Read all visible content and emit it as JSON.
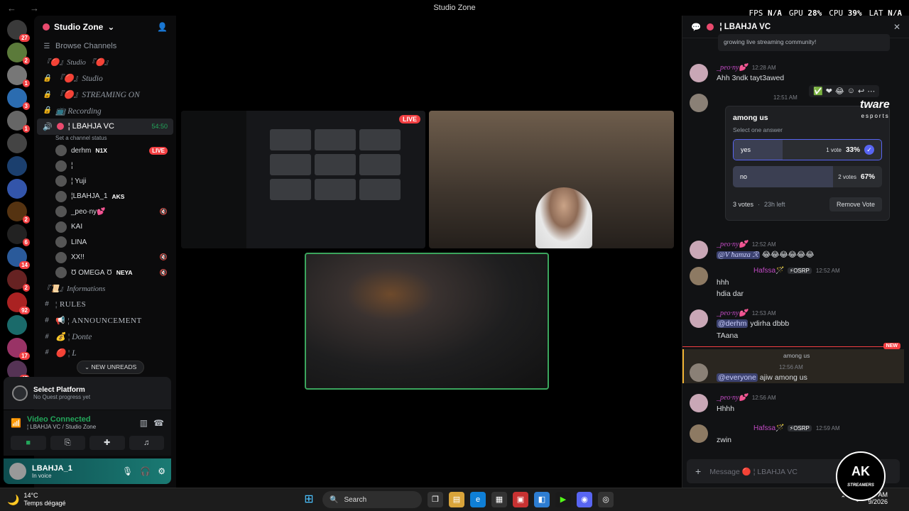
{
  "topbar": {
    "back": "←",
    "forward": "→",
    "title": "Studio Zone"
  },
  "stats": {
    "fps_label": "FPS",
    "fps": "N/A",
    "gpu_label": "GPU",
    "gpu": "28%",
    "cpu_label": "CPU",
    "cpu": "39%",
    "lat_label": "LAT",
    "lat": "N/A"
  },
  "guilds": {
    "badges": [
      "27",
      "2",
      "1",
      "3",
      "1",
      "",
      "",
      "",
      "2",
      "6",
      "14",
      "2",
      "92",
      "",
      "17",
      "47"
    ],
    "new_label": "NEW"
  },
  "server": {
    "name": "Studio Zone",
    "browse": "Browse Channels"
  },
  "channels": [
    {
      "label": "『🔴』Studio 『🔴』",
      "kind": "cat"
    },
    {
      "label": "『🔴』Studio",
      "kind": "it"
    },
    {
      "label": "『🔴』STREAMING ON",
      "kind": "it"
    },
    {
      "label": "📺 Recording",
      "kind": "it"
    }
  ],
  "active_channel": {
    "name": "¦ LBAHJA VC",
    "timer": "54:50",
    "status": "Set a channel status"
  },
  "voice_users": [
    {
      "name": "derhm",
      "tag": "N1X",
      "live": "LIVE"
    },
    {
      "name": "¦",
      "tag": "",
      "live": ""
    },
    {
      "name": "¦ Yuji",
      "tag": "",
      "live": ""
    },
    {
      "name": "¦LBAHJA_1",
      "tag": "AKS",
      "live": ""
    },
    {
      "name": "_peo·ny💕",
      "tag": "",
      "live": ""
    },
    {
      "name": "KAI",
      "tag": "",
      "live": ""
    },
    {
      "name": "LINA",
      "tag": "",
      "live": ""
    },
    {
      "name": "XX!!",
      "tag": "",
      "live": ""
    },
    {
      "name": "Ʊ ОМЕGА Ʊ",
      "tag": "NEYA",
      "live": ""
    }
  ],
  "info_channels": [
    {
      "label": "『📜』Informations",
      "kind": "cat"
    },
    {
      "label": "¦ RULES",
      "kind": "norm"
    },
    {
      "label": "📢 ¦ ANNOUNCEMENT",
      "kind": "norm"
    },
    {
      "label": "💰 ¦ Donte",
      "kind": "it"
    },
    {
      "label": "🔴 ¦ L",
      "kind": "it"
    }
  ],
  "new_unreads": "NEW UNREADS",
  "quest": {
    "title": "Select Platform",
    "subtitle": "No Quest progress yet"
  },
  "voice": {
    "status": "Video Connected",
    "location": "¦ LBAHJA VC / Studio Zone"
  },
  "user": {
    "name": "LBAHJA_1",
    "status": "In voice"
  },
  "stage": {
    "live_label": "LIVE"
  },
  "thread": {
    "title": "¦ LBAHJA VC",
    "intro": "growing live streaming community!",
    "messages": [
      {
        "name": "_peo·ny💕",
        "time": "12:28 AM",
        "text": "Ahh 3ndk tayt3awed"
      },
      {
        "name": "",
        "time": "12:51 AM",
        "text": ""
      },
      {
        "name": "_peo·ny💕",
        "time": "12:52 AM",
        "mention": "@V ħamza ℛ",
        "text": "😂😂😂😂😂😂"
      },
      {
        "name": "Hafssa🪄",
        "badge": "⚡OSRP",
        "time": "12:52 AM",
        "text": "hhh",
        "text2": "hdia dar"
      },
      {
        "name": "_peo·ny💕",
        "time": "12:53 AM",
        "mention": "@derhm",
        "text": "ydirha dbbb",
        "text2": "TAana"
      },
      {
        "name": "",
        "time": "12:56 AM",
        "reply": "among us",
        "mention": "@everyone",
        "text": "ajiw among us"
      },
      {
        "name": "_peo·ny💕",
        "time": "12:56 AM",
        "text": "Hhhh"
      },
      {
        "name": "Hafssa🪄",
        "badge": "⚡OSRP",
        "time": "12:59 AM",
        "text": "zwin"
      }
    ],
    "new_tag": "NEW",
    "input_placeholder": "Message 🔴 ¦ LBAHJA VC"
  },
  "poll": {
    "question": "among us",
    "subtitle": "Select one answer",
    "options": [
      {
        "label": "yes",
        "votes": "1 vote",
        "pct": "33%",
        "share": 0.33
      },
      {
        "label": "no",
        "votes": "2 votes",
        "pct": "67%",
        "share": 0.67
      }
    ],
    "total": "3 votes",
    "time_left": "23h left",
    "remove": "Remove Vote"
  },
  "taskbar": {
    "temp": "14°C",
    "weather": "Temps dégagé",
    "search": "Search",
    "time": "AM",
    "date": "9/2026"
  },
  "overlay": {
    "tware": "tware",
    "tware_sub": "esports",
    "ak": "AK",
    "ak_sub": "STREAMERS"
  }
}
